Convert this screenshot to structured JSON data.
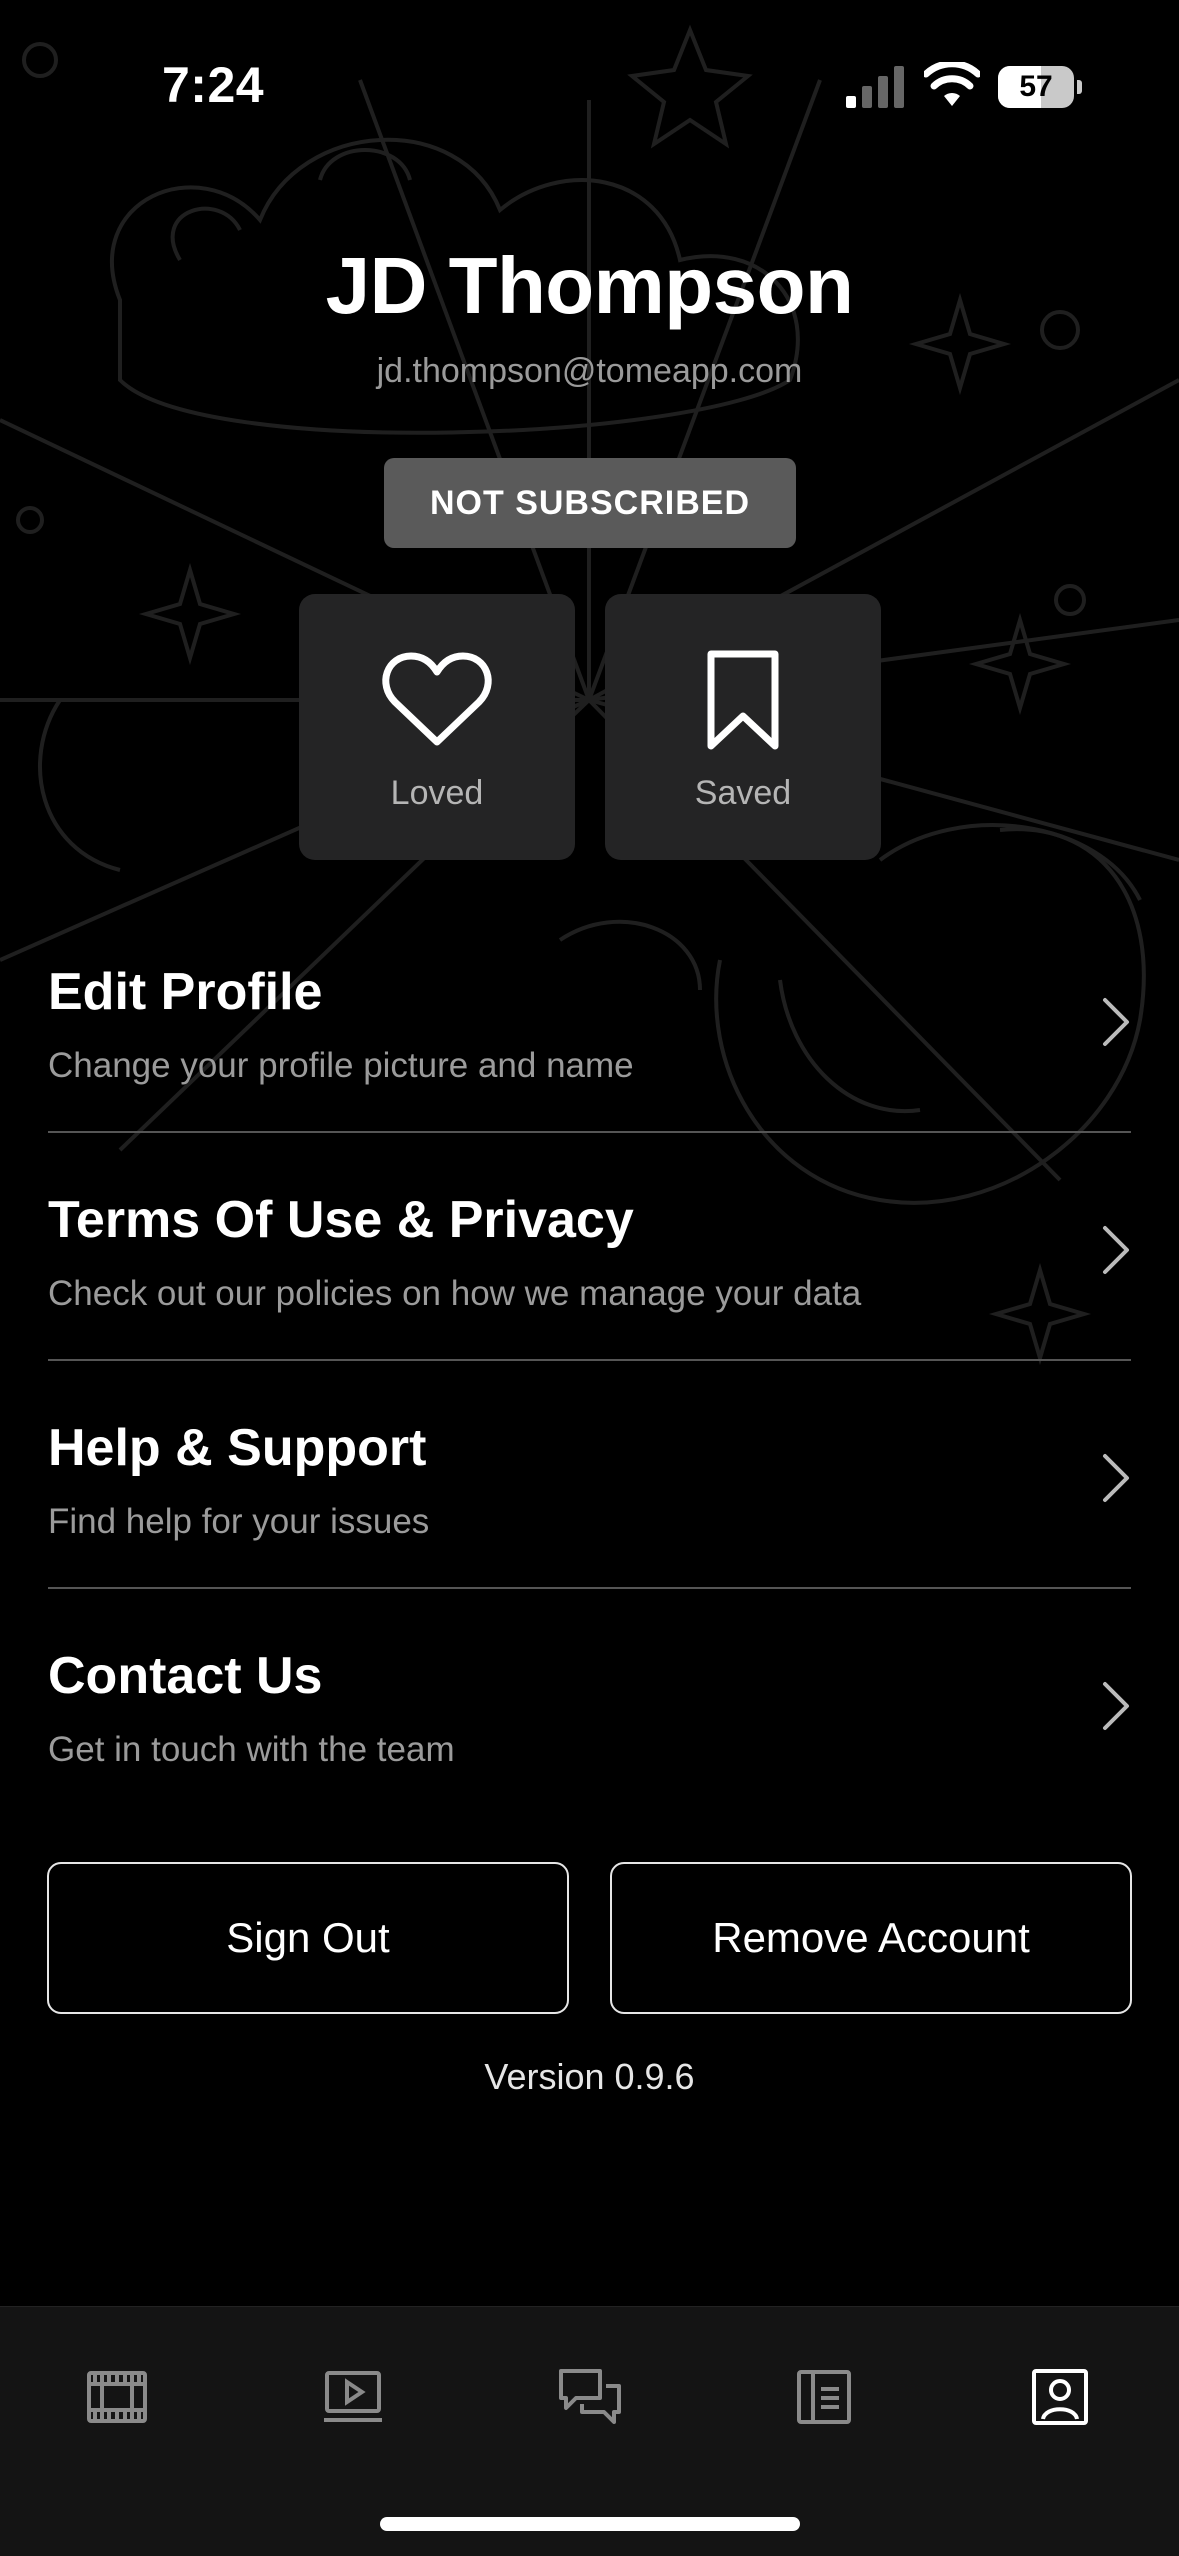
{
  "status_bar": {
    "time": "7:24",
    "battery": "57"
  },
  "profile": {
    "name": "JD Thompson",
    "email": "jd.thompson@tomeapp.com",
    "subscription_status": "NOT SUBSCRIBED"
  },
  "tiles": [
    {
      "label": "Loved",
      "icon": "heart-icon"
    },
    {
      "label": "Saved",
      "icon": "bookmark-icon"
    }
  ],
  "menu": [
    {
      "title": "Edit Profile",
      "subtitle": "Change your profile picture and name"
    },
    {
      "title": "Terms Of Use & Privacy",
      "subtitle": "Check out our policies on how we manage your data"
    },
    {
      "title": "Help & Support",
      "subtitle": "Find help for your issues"
    },
    {
      "title": "Contact Us",
      "subtitle": "Get in touch with the team"
    }
  ],
  "actions": {
    "sign_out": "Sign Out",
    "remove_account": "Remove Account"
  },
  "version": "Version 0.9.6",
  "tab_bar": [
    {
      "icon": "film-icon",
      "active": false
    },
    {
      "icon": "video-icon",
      "active": false
    },
    {
      "icon": "chat-icon",
      "active": false
    },
    {
      "icon": "article-icon",
      "active": false
    },
    {
      "icon": "profile-icon",
      "active": true
    }
  ],
  "colors": {
    "background": "#000000",
    "tile": "#242425",
    "badge": "#5a5a5a",
    "muted_text": "#9b9b9b",
    "tab_bar": "#141414"
  }
}
